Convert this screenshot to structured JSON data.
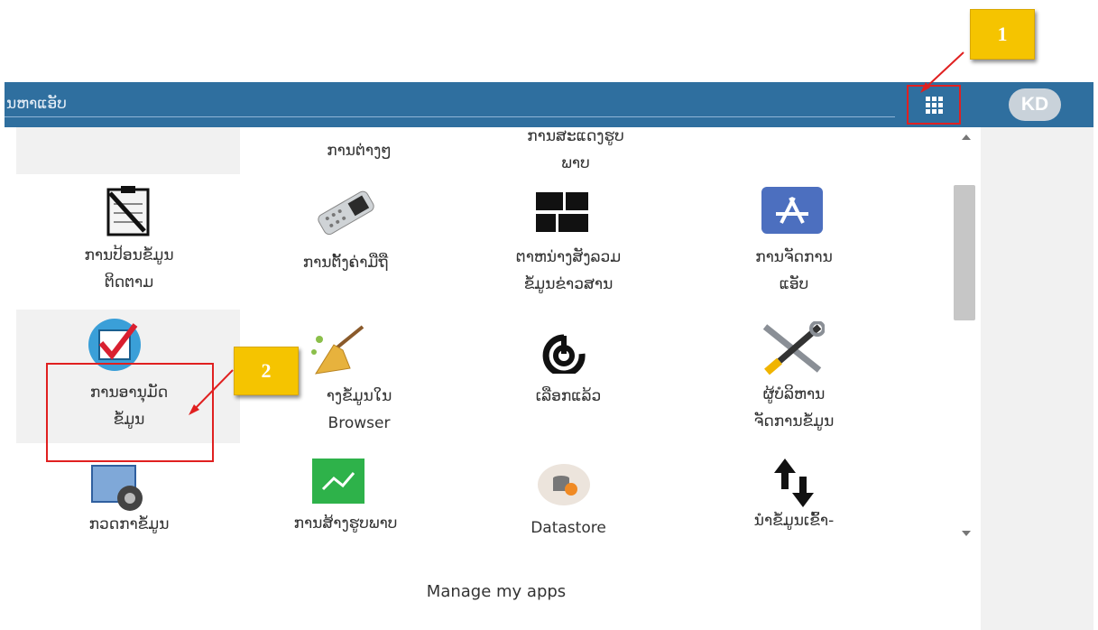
{
  "header": {
    "search_text": "ນຫາແອັບ",
    "avatar_initials": "KD",
    "apps_button_icon": "app-grid-icon",
    "colors": {
      "bar": "#2f6f9f",
      "highlight": "#e02020",
      "callout": "#f5c400"
    }
  },
  "apps": {
    "row0": [
      {
        "label": "ການຕ່າງໆ"
      },
      {
        "label": "ການສະແດງຮູບ",
        "label2": "ພາບ"
      }
    ],
    "row1": [
      {
        "label": "ການປ້ອນຂໍ້ມູນ",
        "label2": "ຕິດຕາມ",
        "icon": "clipboard-checklist-icon"
      },
      {
        "label": "ການຕັ້ງຄ່າມືຖື",
        "icon": "mobile-phone-icon"
      },
      {
        "label": "ຕາຫນ່າງສັງລວມ",
        "label2": "ຂໍ້ມູນຂ່າວສານ",
        "icon": "dashboard-icon"
      },
      {
        "label": "ການຈັດການ",
        "label2": "ແອັບ",
        "icon": "app-store-icon"
      }
    ],
    "row2": [
      {
        "label": "ການອານຸມັດ",
        "label2": "ຂໍ້ມູນ",
        "icon": "approval-check-icon"
      },
      {
        "label": "າງຂໍ້ມູນໃນ",
        "label2": "Browser",
        "icon": "broom-icon"
      },
      {
        "label": "ເລືອກແລ້ວ",
        "icon": "capture-icon"
      },
      {
        "label": "ຜູ້ບໍລິຫານ",
        "label2": "ຈັດການຂໍ້ມູນ",
        "icon": "tools-icon"
      }
    ],
    "row3": [
      {
        "label": "ກວດກາຂໍ້ມູນ",
        "icon": "gear-window-icon"
      },
      {
        "label": "ການສ້າງຮູບພາບ",
        "icon": "line-chart-icon"
      },
      {
        "label": "Datastore",
        "icon": "database-icon"
      },
      {
        "label": "ນໍາຂໍ້ມູນເຂົ້າ-",
        "icon": "import-export-arrows-icon"
      }
    ]
  },
  "footer": {
    "manage_label": "Manage my apps"
  },
  "annotations": {
    "callout1": "1",
    "callout2": "2"
  }
}
